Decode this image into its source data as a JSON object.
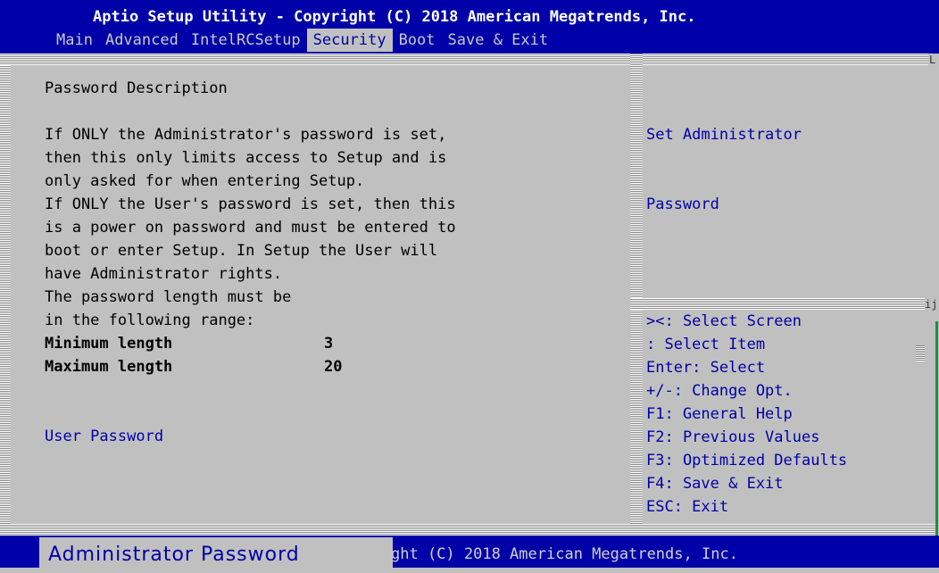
{
  "header": {
    "title": "Aptio Setup Utility - Copyright (C) 2018 American Megatrends, Inc.",
    "tabs": [
      {
        "label": "Main"
      },
      {
        "label": "Advanced"
      },
      {
        "label": "IntelRCSetup"
      },
      {
        "label": "Security"
      },
      {
        "label": "Boot"
      },
      {
        "label": "Save & Exit"
      }
    ],
    "active_tab": "Security"
  },
  "left": {
    "heading": "Password Description",
    "description_lines": [
      "If ONLY the Administrator's password is set,",
      "then this only limits access to Setup and is",
      "only asked for when entering Setup.",
      "If ONLY the User's password is set, then this",
      "is a power on password and must be entered to",
      "boot or enter Setup. In Setup the User will",
      "have Administrator rights.",
      "The password length must be",
      "in the following range:"
    ],
    "min_label": "Minimum length",
    "min_value": "3",
    "max_label": "Maximum length",
    "max_value": "20",
    "user_password": "User Password"
  },
  "right": {
    "help_lines": [
      "Set Administrator",
      "Password"
    ],
    "keys": [
      "><: Select Screen",
      ": Select Item",
      "Enter: Select",
      "+/-: Change Opt.",
      "F1: General Help",
      "F2: Previous Values",
      "F3: Optimized Defaults",
      "F4: Save & Exit",
      "ESC: Exit"
    ]
  },
  "footer": {
    "text": "ght (C) 2018 American Megatrends, Inc.",
    "popup": "Administrator Password"
  },
  "glyphs": {
    "top_corner": "L",
    "mid_corner": "ij"
  },
  "colors": {
    "header_bg": "#0000a8",
    "panel_bg": "#c0c0c0",
    "link": "#0000a8",
    "active_tab_text": "#0000a8"
  }
}
